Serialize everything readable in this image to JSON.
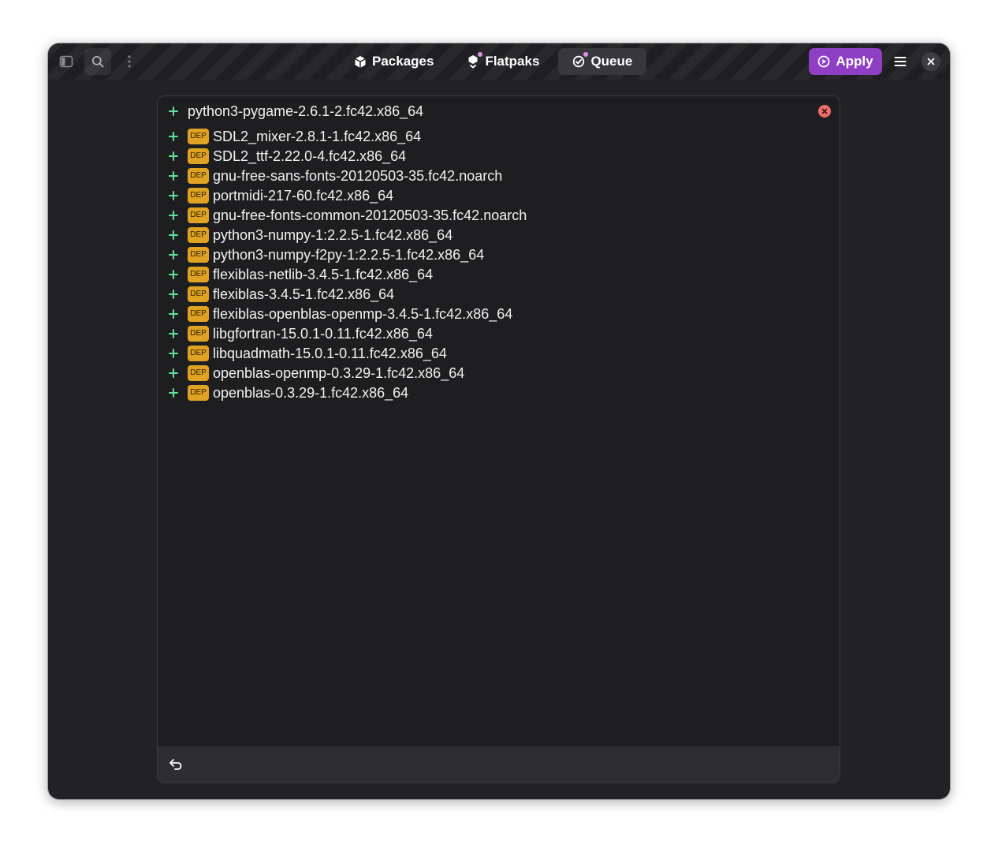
{
  "headerbar": {
    "tabs": [
      {
        "label": "Packages",
        "icon": "package-icon",
        "active": false,
        "indicator": false
      },
      {
        "label": "Flatpaks",
        "icon": "flatpak-icon",
        "active": false,
        "indicator": true
      },
      {
        "label": "Queue",
        "icon": "queue-check-icon",
        "active": true,
        "indicator": true
      }
    ],
    "apply_label": "Apply",
    "accent_color": "#8e3fc4"
  },
  "queue": {
    "package": {
      "action": "+",
      "name": "python3-pygame-2.6.1-2.fc42.x86_64"
    },
    "dependency_badge": "DEP",
    "dependencies": [
      "SDL2_mixer-2.8.1-1.fc42.x86_64",
      "SDL2_ttf-2.22.0-4.fc42.x86_64",
      "gnu-free-sans-fonts-20120503-35.fc42.noarch",
      "portmidi-217-60.fc42.x86_64",
      "gnu-free-fonts-common-20120503-35.fc42.noarch",
      "python3-numpy-1:2.2.5-1.fc42.x86_64",
      "python3-numpy-f2py-1:2.2.5-1.fc42.x86_64",
      "flexiblas-netlib-3.4.5-1.fc42.x86_64",
      "flexiblas-3.4.5-1.fc42.x86_64",
      "flexiblas-openblas-openmp-3.4.5-1.fc42.x86_64",
      "libgfortran-15.0.1-0.11.fc42.x86_64",
      "libquadmath-15.0.1-0.11.fc42.x86_64",
      "openblas-openmp-0.3.29-1.fc42.x86_64",
      "openblas-0.3.29-1.fc42.x86_64"
    ]
  }
}
